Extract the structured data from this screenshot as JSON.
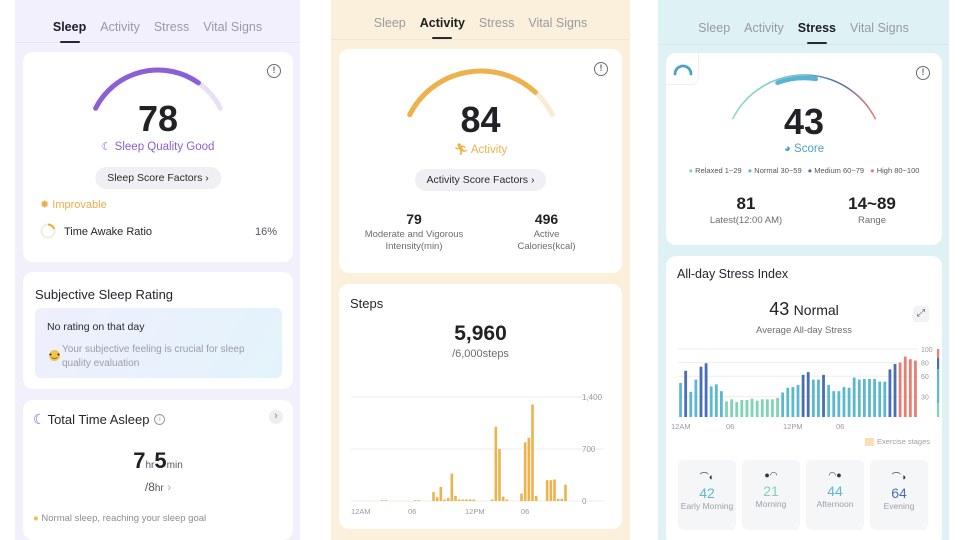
{
  "tabs": [
    "Sleep",
    "Activity",
    "Stress",
    "Vital Signs"
  ],
  "colors": {
    "sleep_accent": "#8b5fd6",
    "activity_accent": "#edb24c",
    "stress_relaxed": "#7fd4b4",
    "stress_normal": "#5bb8cf",
    "stress_medium": "#4a6db8",
    "stress_high": "#e87e72"
  },
  "sleep": {
    "active_tab": "Sleep",
    "score": "78",
    "score_fraction": 0.78,
    "quality_label": "Sleep Quality Good",
    "factors_button": "Sleep Score Factors",
    "improvable_label": "Improvable",
    "awake_ratio_label": "Time Awake Ratio",
    "awake_ratio_value": "16%",
    "awake_ratio_fraction": 0.16,
    "subjective": {
      "title": "Subjective Sleep Rating",
      "no_rating": "No rating on that day",
      "hint": "Your subjective feeling is crucial for sleep quality evaluation"
    },
    "total_asleep": {
      "title": "Total Time Asleep",
      "hours": "7",
      "hours_unit": "hr",
      "minutes": "5",
      "minutes_unit": "min",
      "goal": "/8",
      "goal_unit": "hr",
      "note": "Normal sleep, reaching your sleep goal"
    }
  },
  "activity": {
    "active_tab": "Activity",
    "score": "84",
    "score_fraction": 0.84,
    "label": "Activity",
    "factors_button": "Activity Score Factors",
    "stats": [
      {
        "value": "79",
        "label": "Moderate and Vigorous Intensity(min)"
      },
      {
        "value": "496",
        "label": "Active Calories(kcal)"
      }
    ],
    "steps": {
      "title": "Steps",
      "value": "5,960",
      "goal": "/6,000steps"
    }
  },
  "stress": {
    "active_tab": "Stress",
    "score": "43",
    "label": "Score",
    "legend": [
      {
        "label": "Relaxed 1~29",
        "color": "#7fd4b4"
      },
      {
        "label": "Normal 30~59",
        "color": "#5bb8cf"
      },
      {
        "label": "Medium 60~79",
        "color": "#4a6db8"
      },
      {
        "label": "High 80~100",
        "color": "#e87e72"
      }
    ],
    "latest_value": "81",
    "latest_label": "Latest(12:00 AM)",
    "range_value": "14~89",
    "range_label": "Range",
    "allday": {
      "title": "All-day Stress Index",
      "avg_value": "43",
      "avg_status": "Normal",
      "avg_label": "Average All-day Stress",
      "exercise_legend": "Exercise stages"
    },
    "periods": [
      {
        "value": "42",
        "label": "Early Morning",
        "color": "#5bb8cf"
      },
      {
        "value": "21",
        "label": "Morning",
        "color": "#7fd4b4"
      },
      {
        "value": "44",
        "label": "Afternoon",
        "color": "#5bb8cf"
      },
      {
        "value": "64",
        "label": "Evening",
        "color": "#4a6db8"
      }
    ]
  },
  "chart_data": [
    {
      "type": "bar",
      "title": "Steps",
      "x_tick_labels": [
        "12AM",
        "06",
        "12PM",
        "06"
      ],
      "y_tick_labels": [
        "0",
        "700",
        "1,400"
      ],
      "ylim": [
        0,
        1400
      ],
      "grid": true,
      "values": [
        0,
        0,
        0,
        0,
        0,
        0,
        0,
        0,
        10,
        10,
        0,
        0,
        0,
        0,
        0,
        0,
        0,
        10,
        10,
        0,
        0,
        0,
        120,
        50,
        190,
        20,
        40,
        370,
        70,
        20,
        20,
        20,
        20,
        20,
        0,
        0,
        0,
        0,
        20,
        1000,
        700,
        60,
        20,
        0,
        0,
        0,
        100,
        790,
        850,
        1300,
        70,
        0,
        0,
        280,
        280,
        290,
        30,
        30,
        220,
        0
      ]
    },
    {
      "type": "bar",
      "title": "All-day Stress Index",
      "x_tick_labels": [
        "12AM",
        "06",
        "12PM",
        "06"
      ],
      "y_tick_labels": [
        "30",
        "60",
        "80",
        "100"
      ],
      "ylim": [
        0,
        100
      ],
      "grid": true,
      "values": [
        50,
        68,
        37,
        55,
        74,
        79,
        45,
        48,
        38,
        23,
        26,
        22,
        25,
        25,
        27,
        24,
        26,
        26,
        26,
        28,
        36,
        43,
        44,
        47,
        62,
        66,
        55,
        55,
        62,
        47,
        38,
        38,
        44,
        43,
        58,
        55,
        56,
        56,
        56,
        52,
        52,
        70,
        78,
        80,
        89,
        85,
        83
      ]
    }
  ]
}
